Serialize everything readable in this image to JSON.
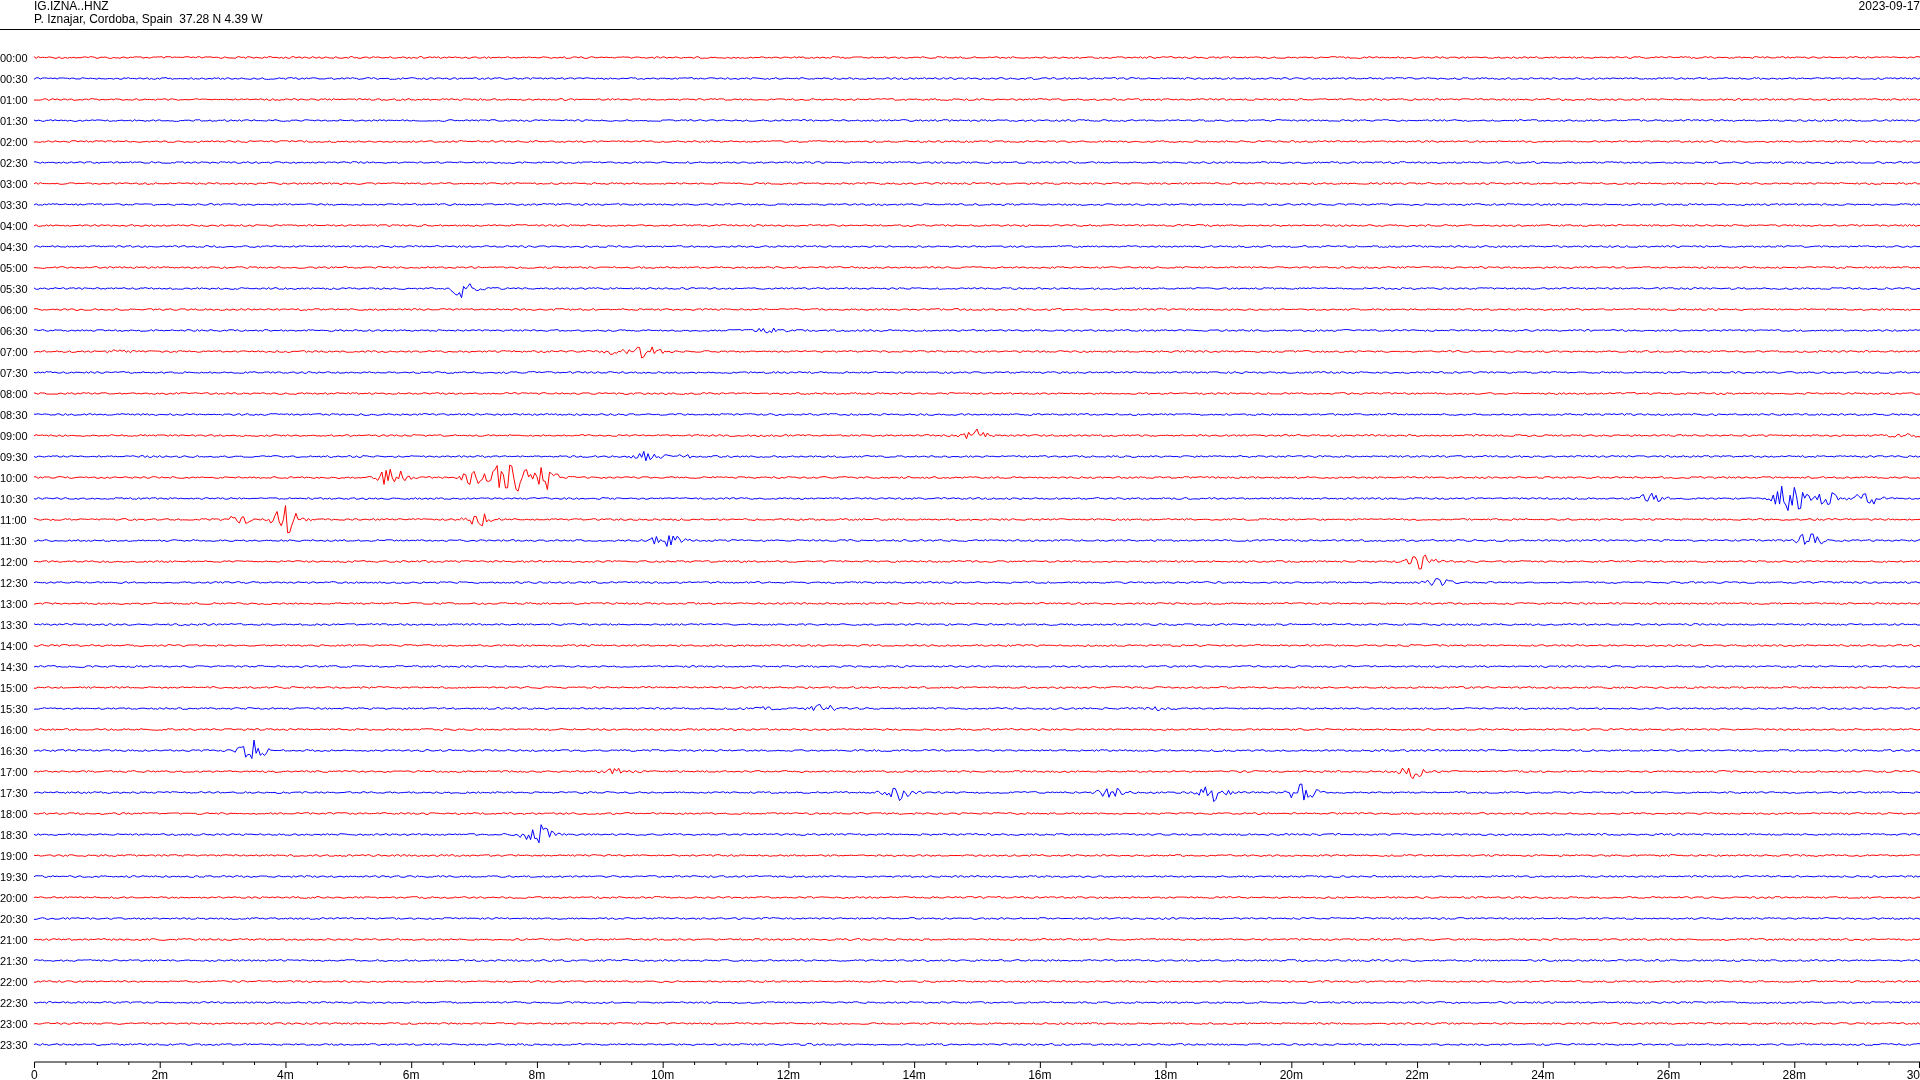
{
  "header": {
    "station": "IG.IZNA..HNZ",
    "location": "P. Iznajar, Cordoba, Spain  37.28 N 4.39 W",
    "date": "2023-09-17"
  },
  "traces": [
    {
      "time": "00:00",
      "color": "#ff0000"
    },
    {
      "time": "00:30",
      "color": "#0000ff"
    },
    {
      "time": "01:00",
      "color": "#ff0000"
    },
    {
      "time": "01:30",
      "color": "#0000ff"
    },
    {
      "time": "02:00",
      "color": "#ff0000"
    },
    {
      "time": "02:30",
      "color": "#0000ff"
    },
    {
      "time": "03:00",
      "color": "#ff0000"
    },
    {
      "time": "03:30",
      "color": "#0000ff"
    },
    {
      "time": "04:00",
      "color": "#ff0000"
    },
    {
      "time": "04:30",
      "color": "#0000ff"
    },
    {
      "time": "05:00",
      "color": "#ff0000"
    },
    {
      "time": "05:30",
      "color": "#0000ff"
    },
    {
      "time": "06:00",
      "color": "#ff0000"
    },
    {
      "time": "06:30",
      "color": "#0000ff"
    },
    {
      "time": "07:00",
      "color": "#ff0000"
    },
    {
      "time": "07:30",
      "color": "#0000ff"
    },
    {
      "time": "08:00",
      "color": "#ff0000"
    },
    {
      "time": "08:30",
      "color": "#0000ff"
    },
    {
      "time": "09:00",
      "color": "#ff0000"
    },
    {
      "time": "09:30",
      "color": "#0000ff"
    },
    {
      "time": "10:00",
      "color": "#ff0000"
    },
    {
      "time": "10:30",
      "color": "#0000ff"
    },
    {
      "time": "11:00",
      "color": "#ff0000"
    },
    {
      "time": "11:30",
      "color": "#0000ff"
    },
    {
      "time": "12:00",
      "color": "#ff0000"
    },
    {
      "time": "12:30",
      "color": "#0000ff"
    },
    {
      "time": "13:00",
      "color": "#ff0000"
    },
    {
      "time": "13:30",
      "color": "#0000ff"
    },
    {
      "time": "14:00",
      "color": "#ff0000"
    },
    {
      "time": "14:30",
      "color": "#0000ff"
    },
    {
      "time": "15:00",
      "color": "#ff0000"
    },
    {
      "time": "15:30",
      "color": "#0000ff"
    },
    {
      "time": "16:00",
      "color": "#ff0000"
    },
    {
      "time": "16:30",
      "color": "#0000ff"
    },
    {
      "time": "17:00",
      "color": "#ff0000"
    },
    {
      "time": "17:30",
      "color": "#0000ff"
    },
    {
      "time": "18:00",
      "color": "#ff0000"
    },
    {
      "time": "18:30",
      "color": "#0000ff"
    },
    {
      "time": "19:00",
      "color": "#ff0000"
    },
    {
      "time": "19:30",
      "color": "#0000ff"
    },
    {
      "time": "20:00",
      "color": "#ff0000"
    },
    {
      "time": "20:30",
      "color": "#0000ff"
    },
    {
      "time": "21:00",
      "color": "#ff0000"
    },
    {
      "time": "21:30",
      "color": "#0000ff"
    },
    {
      "time": "22:00",
      "color": "#ff0000"
    },
    {
      "time": "22:30",
      "color": "#0000ff"
    },
    {
      "time": "23:00",
      "color": "#ff0000"
    },
    {
      "time": "23:30",
      "color": "#0000ff"
    }
  ],
  "x_axis": {
    "labels": [
      "0",
      "2m",
      "4m",
      "6m",
      "8m",
      "10m",
      "12m",
      "14m",
      "16m",
      "18m",
      "20m",
      "22m",
      "24m",
      "26m",
      "28m",
      "30"
    ]
  }
}
